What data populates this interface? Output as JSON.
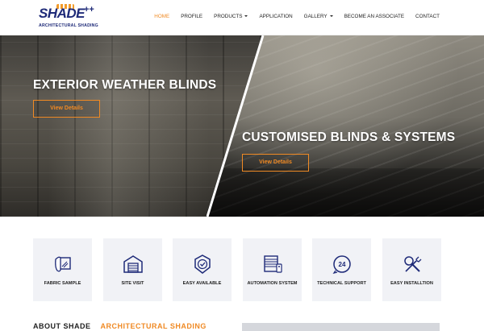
{
  "brand": {
    "name": "SHADE",
    "plus": "++",
    "tagline": "ARCHITECTURAL SHADING"
  },
  "nav": {
    "items": [
      {
        "label": "HOME",
        "active": true,
        "dropdown": false
      },
      {
        "label": "PROFILE",
        "active": false,
        "dropdown": false
      },
      {
        "label": "PRODUCTS",
        "active": false,
        "dropdown": true
      },
      {
        "label": "APPLICATION",
        "active": false,
        "dropdown": false
      },
      {
        "label": "GALLERY",
        "active": false,
        "dropdown": true
      },
      {
        "label": "BECOME AN ASSOCIATE",
        "active": false,
        "dropdown": false
      },
      {
        "label": "CONTACT",
        "active": false,
        "dropdown": false
      }
    ]
  },
  "hero": {
    "left": {
      "title": "EXTERIOR WEATHER BLINDS",
      "button": "View Details"
    },
    "right": {
      "title": "CUSTOMISED BLINDS & SYSTEMS",
      "button": "View Details"
    }
  },
  "features": [
    {
      "label": "FABRIC SAMPLE",
      "icon": "fabric-sample-icon"
    },
    {
      "label": "SITE VISIT",
      "icon": "garage-icon"
    },
    {
      "label": "EASY AVAILABLE",
      "icon": "badge-check-icon"
    },
    {
      "label": "AUTOMATION SYSTEM",
      "icon": "blinds-remote-icon"
    },
    {
      "label": "TECHNICAL SUPPORT",
      "icon": "support-24-icon"
    },
    {
      "label": "EASY INSTALLTION",
      "icon": "tools-icon"
    }
  ],
  "about": {
    "part1": "ABOUT SHADE",
    "part2": "ARCHITECTURAL SHADING"
  },
  "colors": {
    "accent": "#f08a24",
    "brand": "#1e2a78",
    "card": "#f1f2f6"
  }
}
